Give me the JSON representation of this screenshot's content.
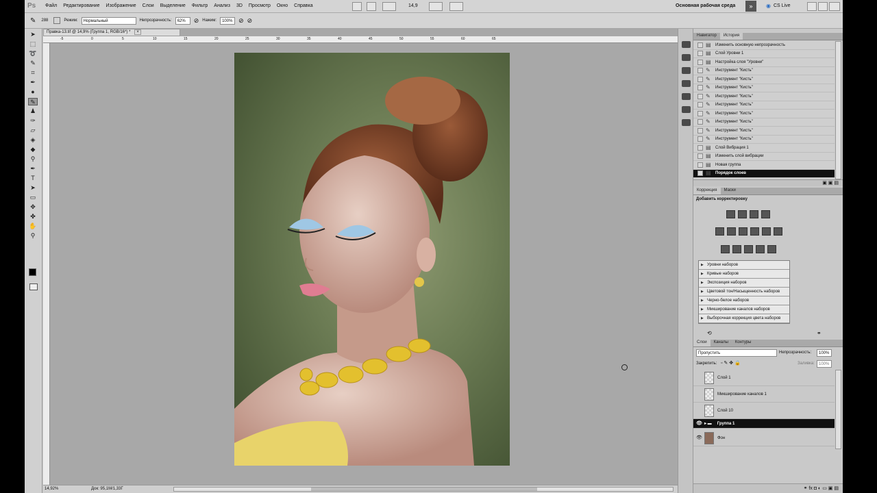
{
  "app": {
    "logo": "Ps",
    "workspace": "Основная рабочая среда",
    "cs_live": "CS Live"
  },
  "menu": [
    "Файл",
    "Редактирование",
    "Изображение",
    "Слои",
    "Выделение",
    "Фильтр",
    "Анализ",
    "3D",
    "Просмотр",
    "Окно",
    "Справка"
  ],
  "zoom_top": "14,9",
  "options": {
    "brush_size": "288",
    "mode_label": "Режим:",
    "mode_value": "Нормальный",
    "opacity_label": "Непрозрачность:",
    "opacity_value": "62%",
    "flow_label": "Нажим:",
    "flow_value": "100%"
  },
  "doc_tab": "Правка-13.tif @ 14,9% (Группа 1, RGB/16*) *",
  "ruler_ticks": [
    "-5",
    "0",
    "5",
    "10",
    "15",
    "20",
    "25",
    "30",
    "35",
    "40",
    "45",
    "50",
    "55",
    "60",
    "65"
  ],
  "status": {
    "zoom": "14,92%",
    "doc": "Док: 95,1М/1,33Г"
  },
  "history_tabs": [
    "Навигатор",
    "История"
  ],
  "history": [
    {
      "label": "Изменить основную непрозрачность",
      "icon": "doc"
    },
    {
      "label": "Слой Уровни 1",
      "icon": "doc"
    },
    {
      "label": "Настройка слоя \"Уровни\"",
      "icon": "doc"
    },
    {
      "label": "Инструмент \"Кисть\"",
      "icon": "brush"
    },
    {
      "label": "Инструмент \"Кисть\"",
      "icon": "brush"
    },
    {
      "label": "Инструмент \"Кисть\"",
      "icon": "brush"
    },
    {
      "label": "Инструмент \"Кисть\"",
      "icon": "brush"
    },
    {
      "label": "Инструмент \"Кисть\"",
      "icon": "brush"
    },
    {
      "label": "Инструмент \"Кисть\"",
      "icon": "brush"
    },
    {
      "label": "Инструмент \"Кисть\"",
      "icon": "brush"
    },
    {
      "label": "Инструмент \"Кисть\"",
      "icon": "brush"
    },
    {
      "label": "Инструмент \"Кисть\"",
      "icon": "brush"
    },
    {
      "label": "Слой Вибрация 1",
      "icon": "doc"
    },
    {
      "label": "Изменить слой вибрации",
      "icon": "doc"
    },
    {
      "label": "Новая группа",
      "icon": "doc"
    },
    {
      "label": "Порядок слоев",
      "icon": "doc"
    }
  ],
  "adjust_tabs": [
    "Коррекция",
    "Маски"
  ],
  "adjust_title": "Добавить корректировку",
  "presets": [
    "Уровни наборов",
    "Кривые наборов",
    "Экспозиция наборов",
    "Цветовой тон/Насыщенность наборов",
    "Черно-белое наборов",
    "Микширование каналов наборов",
    "Выборочная коррекция цвета наборов"
  ],
  "layers_tabs": [
    "Слои",
    "Каналы",
    "Контуры"
  ],
  "layers": {
    "blend": "Пропустить",
    "opacity_label": "Непрозрачность:",
    "opacity_value": "100%",
    "lock_label": "Закрепить:",
    "fill_label": "Заливка:",
    "fill_value": "100%",
    "items": [
      {
        "name": "Слой 1",
        "visible": false
      },
      {
        "name": "Микширование каналов 1",
        "visible": false
      },
      {
        "name": "Слой 10",
        "visible": false
      },
      {
        "name": "Группа 1",
        "visible": true
      },
      {
        "name": "Фон",
        "visible": true
      }
    ]
  }
}
